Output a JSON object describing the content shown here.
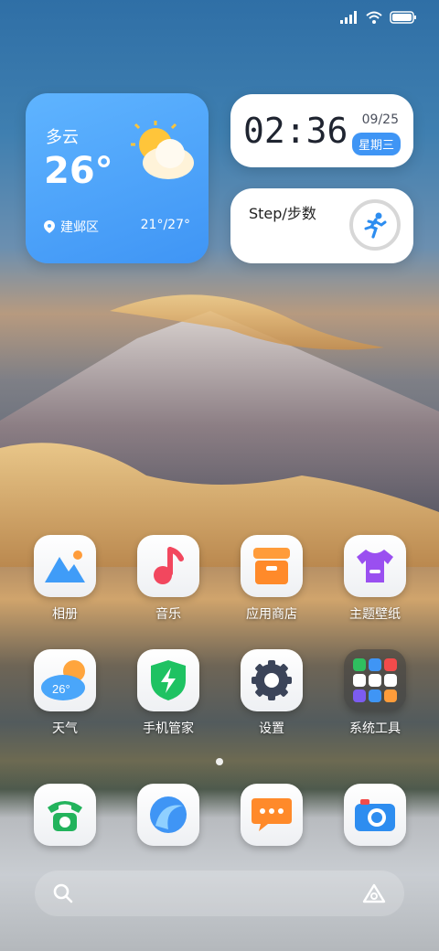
{
  "status_bar": {
    "signal_icon": "cellular-signal-icon",
    "wifi_icon": "wifi-icon",
    "battery_icon": "battery-icon"
  },
  "weather_widget": {
    "condition": "多云",
    "temperature": "26°",
    "location": "建邺区",
    "range": "21°/27°",
    "icon": "partly-cloudy-icon"
  },
  "clock_widget": {
    "time": "02:36",
    "date": "09/25",
    "weekday": "星期三"
  },
  "steps_widget": {
    "label": "Step/步数",
    "icon": "running-person-icon"
  },
  "apps_row1": [
    {
      "label": "相册",
      "icon": "gallery-icon"
    },
    {
      "label": "音乐",
      "icon": "music-icon"
    },
    {
      "label": "应用商店",
      "icon": "app-store-icon"
    },
    {
      "label": "主题壁纸",
      "icon": "theme-icon"
    }
  ],
  "apps_row2": [
    {
      "label": "天气",
      "icon": "weather-icon",
      "badge": "26°"
    },
    {
      "label": "手机管家",
      "icon": "security-shield-icon"
    },
    {
      "label": "设置",
      "icon": "settings-gear-icon"
    },
    {
      "label": "系统工具",
      "icon": "folder-icon"
    }
  ],
  "dock": [
    {
      "icon": "phone-icon"
    },
    {
      "icon": "browser-icon"
    },
    {
      "icon": "messages-icon"
    },
    {
      "icon": "camera-icon"
    }
  ],
  "search_bar": {
    "search_icon": "search-icon",
    "assistant_icon": "assistant-icon"
  },
  "colors": {
    "accent": "#3f95f5",
    "weather_bg": "#4ea6fa"
  }
}
